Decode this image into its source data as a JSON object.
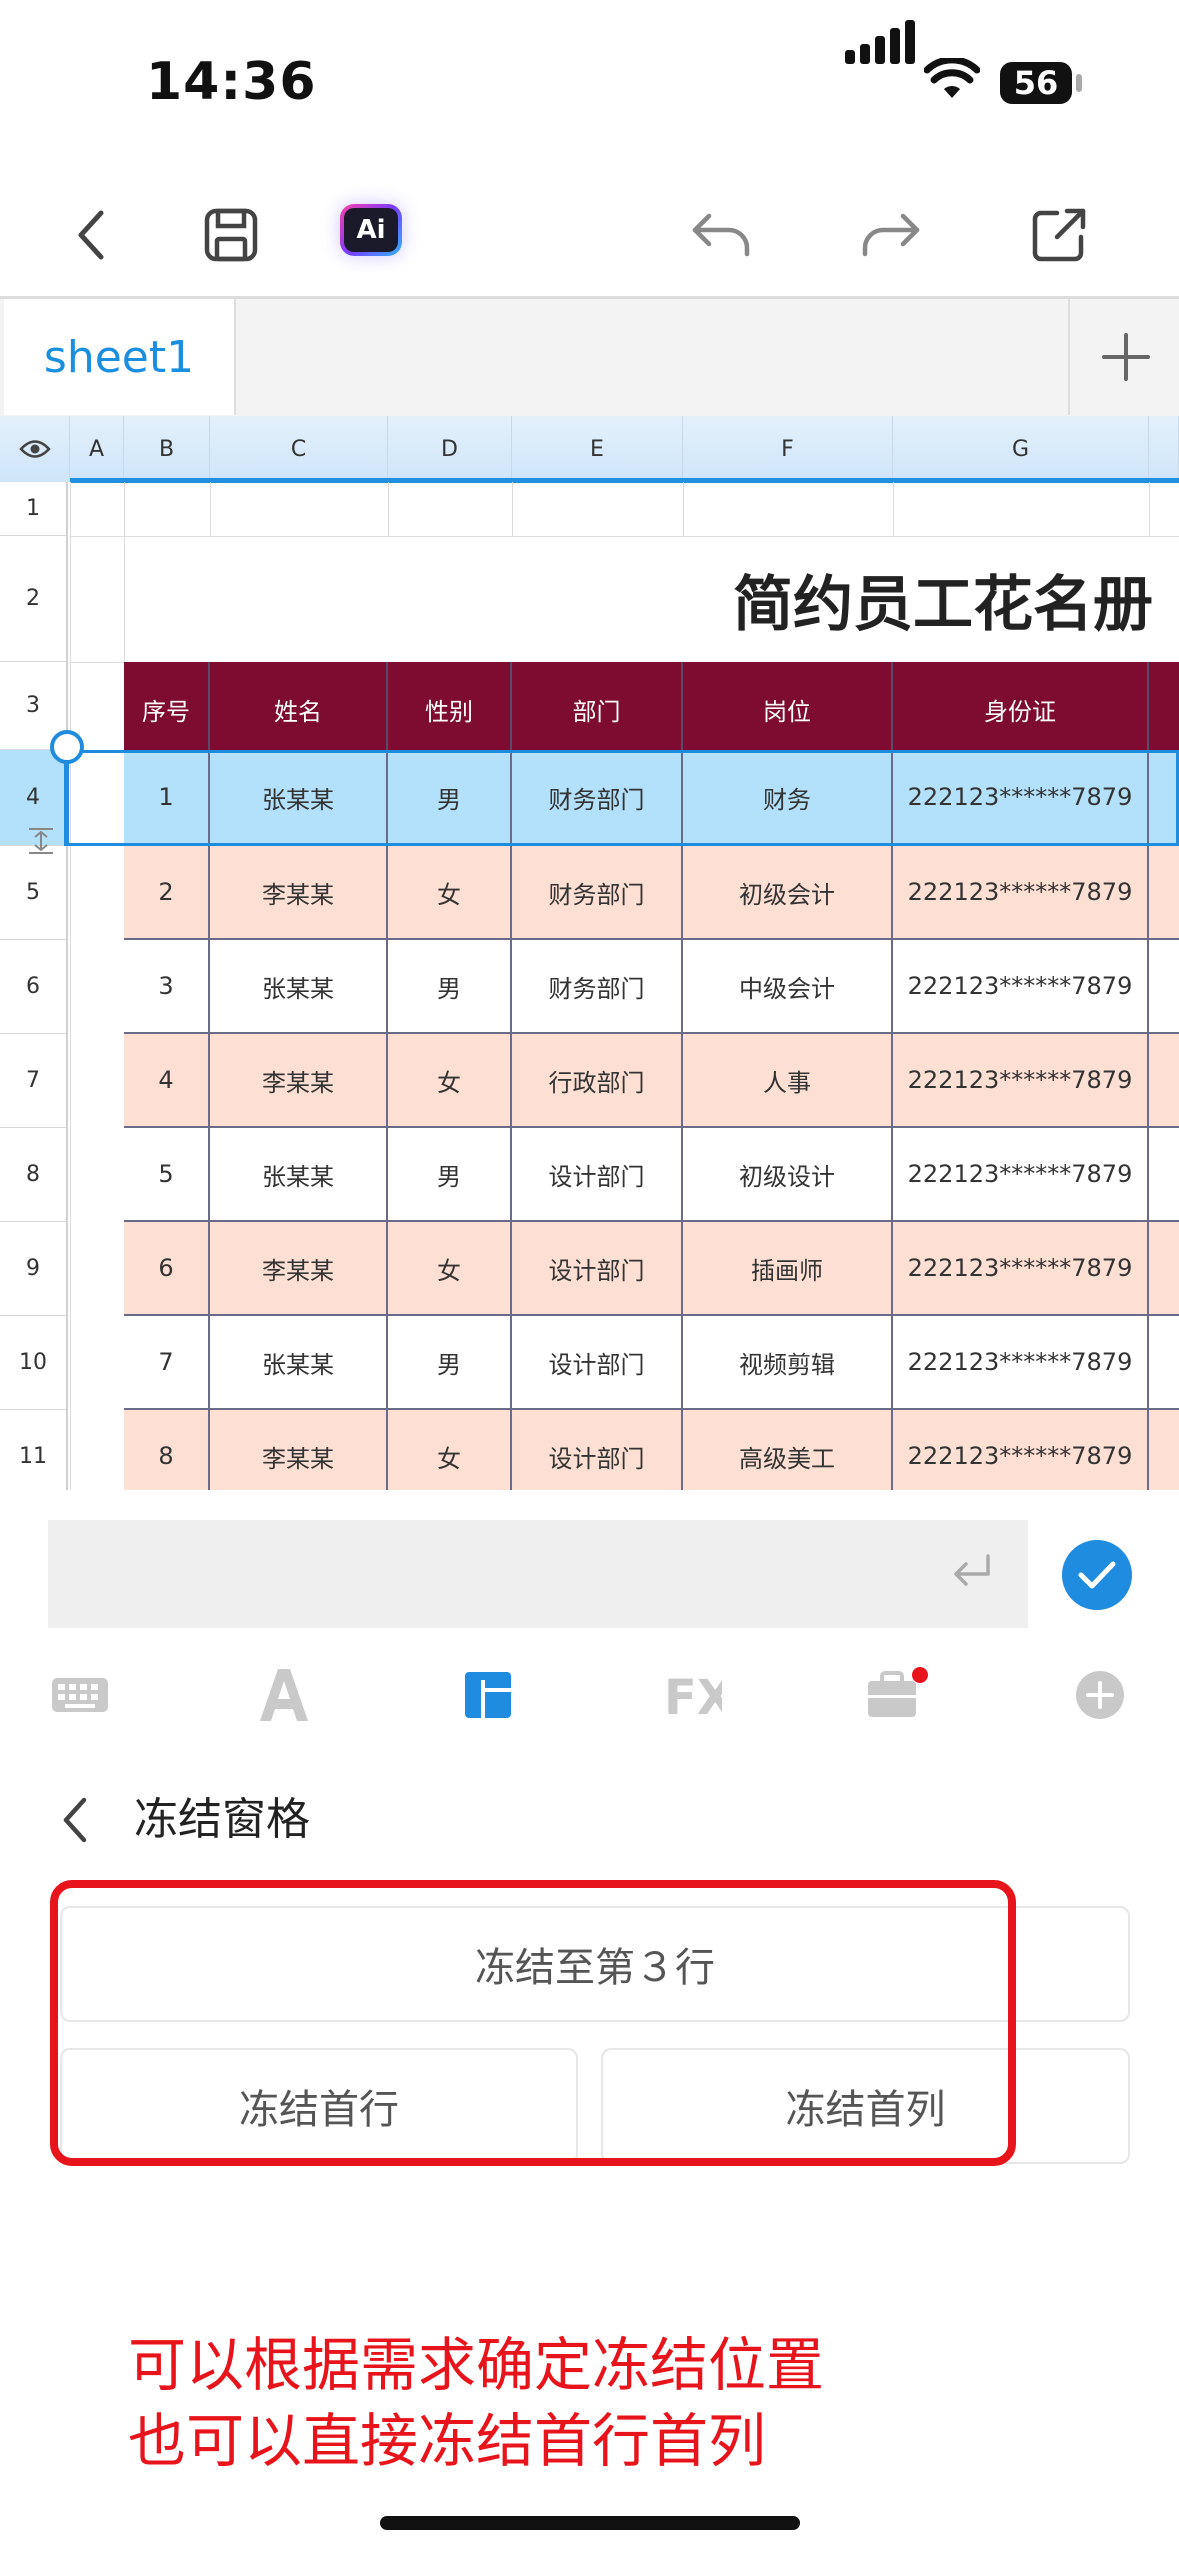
{
  "status": {
    "time": "14:36",
    "battery": "56"
  },
  "toolbar": {
    "back": "back-icon",
    "save": "save-icon",
    "ai": "Ai",
    "undo": "undo-icon",
    "redo": "redo-icon",
    "share": "share-icon"
  },
  "sheet_tabs": {
    "active": "sheet1",
    "add": "+"
  },
  "grid": {
    "columns": [
      "A",
      "B",
      "C",
      "D",
      "E",
      "F",
      "G"
    ],
    "rows": [
      "1",
      "2",
      "3",
      "4",
      "5",
      "6",
      "7",
      "8",
      "9",
      "10",
      "11"
    ],
    "title": "简约员工花名册",
    "headers": [
      "序号",
      "姓名",
      "性别",
      "部门",
      "岗位",
      "身份证"
    ],
    "data": [
      [
        "1",
        "张某某",
        "男",
        "财务部门",
        "财务",
        "222123******7879"
      ],
      [
        "2",
        "李某某",
        "女",
        "财务部门",
        "初级会计",
        "222123******7879"
      ],
      [
        "3",
        "张某某",
        "男",
        "财务部门",
        "中级会计",
        "222123******7879"
      ],
      [
        "4",
        "李某某",
        "女",
        "行政部门",
        "人事",
        "222123******7879"
      ],
      [
        "5",
        "张某某",
        "男",
        "设计部门",
        "初级设计",
        "222123******7879"
      ],
      [
        "6",
        "李某某",
        "女",
        "设计部门",
        "插画师",
        "222123******7879"
      ],
      [
        "7",
        "张某某",
        "男",
        "设计部门",
        "视频剪辑",
        "222123******7879"
      ],
      [
        "8",
        "李某某",
        "女",
        "设计部门",
        "高级美工",
        "222123******7879"
      ]
    ],
    "colors": {
      "header_bg": "#7e0c31",
      "band_bg": "#fde0d3",
      "selected_bg": "#b3e0fa",
      "accent": "#1f8ce0"
    }
  },
  "input": {
    "value": "",
    "enter_icon": "enter-icon"
  },
  "bottom_tabs": [
    "keyboard-icon",
    "font-icon",
    "layout-icon",
    "fx-icon",
    "toolbox-icon",
    "plus-icon"
  ],
  "panel": {
    "title": "冻结窗格",
    "options": {
      "freeze_to_row": "冻结至第３行",
      "freeze_first_row": "冻结首行",
      "freeze_first_col": "冻结首列"
    }
  },
  "annotation": {
    "line1": "可以根据需求确定冻结位置",
    "line2": "也可以直接冻结首行首列"
  }
}
